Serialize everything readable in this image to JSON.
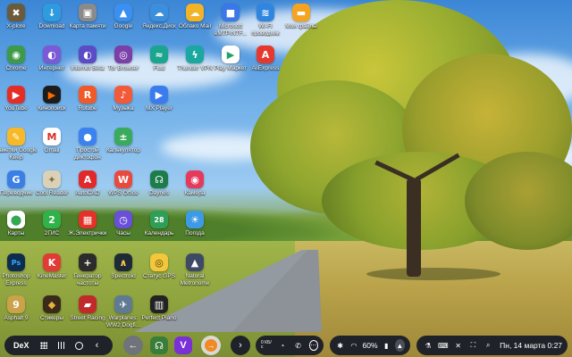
{
  "desktop": {
    "apps": [
      {
        "label": "X-plore",
        "icon": "xplore-icon",
        "color": "#6b5b3a",
        "glyph": "✖"
      },
      {
        "label": "Download",
        "icon": "download-icon",
        "color": "#2e9be0",
        "glyph": "↓"
      },
      {
        "label": "Карта памяти",
        "icon": "sdcard-icon",
        "color": "#8a8a8a",
        "glyph": "▣"
      },
      {
        "label": "Google",
        "icon": "google-drive-icon",
        "color": "#3a8ff0",
        "glyph": "▲"
      },
      {
        "label": "Яндекс.Диск",
        "icon": "yandex-disk-icon",
        "color": "#3c8fdc",
        "glyph": "☁"
      },
      {
        "label": "Облако Mail",
        "icon": "cloud-mail-icon",
        "color": "#f2b327",
        "glyph": "☁"
      },
      {
        "label": "Microsoft eMTP/NTF...",
        "icon": "microsoft-icon",
        "color": "#3b78e7",
        "glyph": "■"
      },
      {
        "label": "Wi-Fi проводник",
        "icon": "wifi-explorer-icon",
        "color": "#2f86e0",
        "glyph": "≋"
      },
      {
        "label": "Мои файлы",
        "icon": "my-files-icon",
        "color": "#f4a421",
        "glyph": "▬"
      },
      {
        "label": "Chrome",
        "icon": "chrome-icon",
        "color": "#3d9a48",
        "glyph": "◉"
      },
      {
        "label": "Интернет",
        "icon": "samsung-internet-icon",
        "color": "#7a5ad6",
        "glyph": "◐"
      },
      {
        "label": "Internet Beta",
        "icon": "samsung-internet-beta-icon",
        "color": "#5b4bc4",
        "glyph": "◐"
      },
      {
        "label": "Tor Browser",
        "icon": "tor-browser-icon",
        "color": "#7b3fa8",
        "glyph": "◎"
      },
      {
        "label": "Flud",
        "icon": "flud-icon",
        "color": "#1aa58f",
        "glyph": "≈"
      },
      {
        "label": "Thunder VPN",
        "icon": "thunder-vpn-icon",
        "color": "#1aa8a0",
        "glyph": "ϟ"
      },
      {
        "label": "Play Маркет",
        "icon": "play-market-icon",
        "color": "#ffffff",
        "glyph": "▶",
        "fg": "#20a464"
      },
      {
        "label": "AliExpress",
        "icon": "aliexpress-icon",
        "color": "#e6392e",
        "glyph": "A"
      },
      {
        "label": "YouTube",
        "icon": "youtube-icon",
        "color": "#e52d27",
        "glyph": "▶"
      },
      {
        "label": "Кинопоиск",
        "icon": "kinopoisk-icon",
        "color": "#1c1c1c",
        "glyph": "▶",
        "fg": "#ff6a00"
      },
      {
        "label": "Rutube",
        "icon": "rutube-icon",
        "color": "#f05a28",
        "glyph": "R"
      },
      {
        "label": "Музыка",
        "icon": "music-icon",
        "color": "#f25b3a",
        "glyph": "♪"
      },
      {
        "label": "MX Player",
        "icon": "mx-player-icon",
        "color": "#3a7bf0",
        "glyph": "▶"
      },
      {
        "label": "Заметки Google Keep",
        "icon": "google-keep-icon",
        "color": "#f7b928",
        "glyph": "✎"
      },
      {
        "label": "Gmail",
        "icon": "gmail-icon",
        "color": "#ffffff",
        "glyph": "M",
        "fg": "#d93025"
      },
      {
        "label": "Простой диктофон",
        "icon": "dictaphone-icon",
        "color": "#3b82f0",
        "glyph": "●"
      },
      {
        "label": "Калькулятор",
        "icon": "calculator-icon",
        "color": "#3aaa5c",
        "glyph": "±"
      },
      {
        "label": "Переводчик",
        "icon": "translate-icon",
        "color": "#3b7fe6",
        "glyph": "G"
      },
      {
        "label": "Cool Reader",
        "icon": "cool-reader-icon",
        "color": "#d9d1b8",
        "glyph": "✦",
        "fg": "#8a6a30"
      },
      {
        "label": "AutoCAD",
        "icon": "autocad-icon",
        "color": "#e1292c",
        "glyph": "A"
      },
      {
        "label": "WPS Office",
        "icon": "wps-office-icon",
        "color": "#e84a3f",
        "glyph": "W"
      },
      {
        "label": "Daynes",
        "icon": "daynes-icon",
        "color": "#1c7c4a",
        "glyph": "☊"
      },
      {
        "label": "Камера",
        "icon": "camera-icon",
        "color": "#e63a5c",
        "glyph": "◉"
      },
      {
        "label": "Карты",
        "icon": "maps-icon",
        "color": "#ffffff",
        "glyph": "⬤",
        "fg": "#34a853"
      },
      {
        "label": "2ГИС",
        "icon": "2gis-icon",
        "color": "#2fb24a",
        "glyph": "2"
      },
      {
        "label": "Ж.Электрички",
        "icon": "trains-icon",
        "color": "#e4322b",
        "glyph": "▦"
      },
      {
        "label": "Часы",
        "icon": "clock-icon",
        "color": "#6a4fd8",
        "glyph": "◷"
      },
      {
        "label": "Календарь",
        "icon": "calendar-icon",
        "color": "#2f9e57",
        "glyph": "28"
      },
      {
        "label": "Погода",
        "icon": "weather-icon",
        "color": "#3f9ae6",
        "glyph": "☀"
      },
      {
        "label": "Photoshop Express",
        "icon": "photoshop-express-icon",
        "color": "#0e2d4e",
        "glyph": "Ps",
        "fg": "#31a8ff"
      },
      {
        "label": "KineMaster",
        "icon": "kinemaster-icon",
        "color": "#e23a34",
        "glyph": "K"
      },
      {
        "label": "Генератор частоты",
        "icon": "frequency-generator-icon",
        "color": "#2c2c2c",
        "glyph": "+"
      },
      {
        "label": "Spectroid",
        "icon": "spectroid-icon",
        "color": "#1e2a36",
        "glyph": "∧",
        "fg": "#ffd24a"
      },
      {
        "label": "Статус GPS",
        "icon": "gps-status-icon",
        "color": "#f2c73a",
        "glyph": "◎",
        "fg": "#4a3a10"
      },
      {
        "label": "Natural Metronome",
        "icon": "metronome-icon",
        "color": "#3d4a66",
        "glyph": "▲"
      },
      {
        "label": "Asphalt 9",
        "icon": "asphalt-icon",
        "color": "#c9a24a",
        "glyph": "9"
      },
      {
        "label": "Стикеры",
        "icon": "stickers-icon",
        "color": "#3a2a1a",
        "glyph": "◆",
        "fg": "#e8b33a"
      },
      {
        "label": "Street Racing",
        "icon": "street-racing-icon",
        "color": "#c02a2a",
        "glyph": "▰"
      },
      {
        "label": "Warplanes: WW2 Dogfi...",
        "icon": "warplanes-icon",
        "color": "#5f7a92",
        "glyph": "✈"
      },
      {
        "label": "Perfect Piano",
        "icon": "perfect-piano-icon",
        "color": "#222222",
        "glyph": "▥"
      }
    ]
  },
  "taskbar": {
    "dex_label": "DeX",
    "status": {
      "battery": "60%",
      "datetime": "Пн, 14 марта 0:27",
      "network_speed": "0 КБ/с"
    },
    "accent": "#1f2228"
  }
}
